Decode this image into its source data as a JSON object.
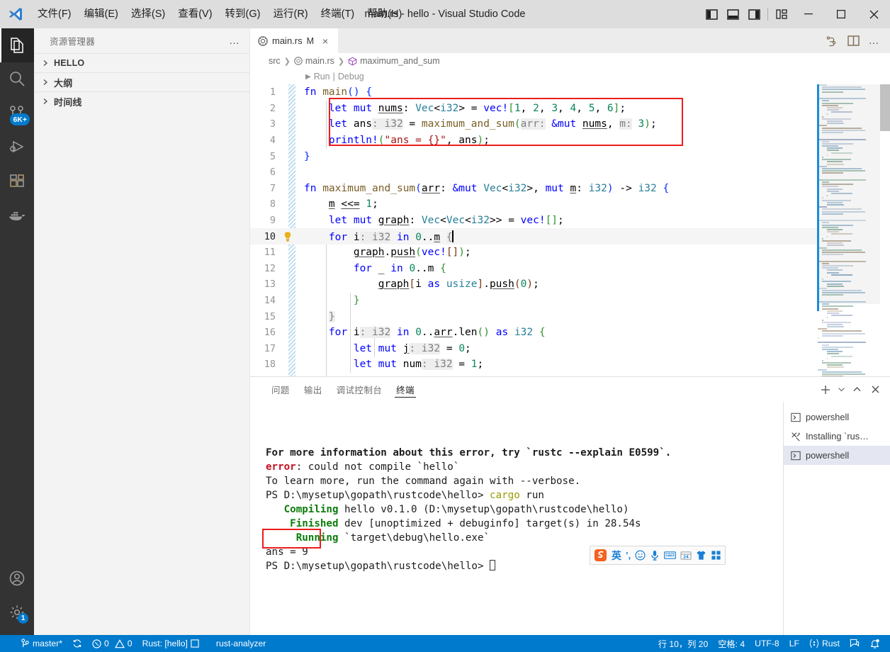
{
  "window": {
    "title": "main.rs - hello - Visual Studio Code",
    "logo_icon": "vscode-logo-icon"
  },
  "menubar": {
    "items": [
      {
        "label": "文件(F)",
        "mnemonic": "F"
      },
      {
        "label": "编辑(E)",
        "mnemonic": "E"
      },
      {
        "label": "选择(S)",
        "mnemonic": "S"
      },
      {
        "label": "查看(V)",
        "mnemonic": "V"
      },
      {
        "label": "转到(G)",
        "mnemonic": "G"
      },
      {
        "label": "运行(R)",
        "mnemonic": "R"
      },
      {
        "label": "终端(T)",
        "mnemonic": "T"
      },
      {
        "label": "帮助(H)",
        "mnemonic": "H"
      }
    ]
  },
  "titlebar_controls": {
    "toggle_primary_sidebar": "toggle-primary-sidebar-icon",
    "toggle_panel": "toggle-panel-icon",
    "toggle_secondary_sidebar": "toggle-secondary-sidebar-icon",
    "customize_layout": "customize-layout-icon",
    "minimize": "minimize-icon",
    "maximize": "maximize-icon",
    "close": "close-icon"
  },
  "activitybar": {
    "items": [
      {
        "name": "explorer",
        "icon": "files-icon",
        "active": true,
        "badge": ""
      },
      {
        "name": "search",
        "icon": "search-icon",
        "active": false,
        "badge": ""
      },
      {
        "name": "source-control",
        "icon": "source-control-icon",
        "active": false,
        "badge": "6K+"
      },
      {
        "name": "run-and-debug",
        "icon": "run-and-debug-icon",
        "active": false,
        "badge": ""
      },
      {
        "name": "extensions",
        "icon": "extensions-icon",
        "active": false,
        "badge": ""
      },
      {
        "name": "docker",
        "icon": "docker-icon",
        "active": false,
        "badge": ""
      }
    ],
    "bottom_items": [
      {
        "name": "accounts",
        "icon": "account-icon",
        "badge": ""
      },
      {
        "name": "settings",
        "icon": "gear-icon",
        "badge": "1"
      }
    ]
  },
  "sidebar": {
    "title": "资源管理器",
    "more_actions": "…",
    "sections": [
      {
        "label": "HELLO",
        "expanded": false,
        "cjk": false
      },
      {
        "label": "大纲",
        "expanded": false,
        "cjk": true
      },
      {
        "label": "时间线",
        "expanded": false,
        "cjk": true
      }
    ]
  },
  "editor": {
    "tab": {
      "filename": "main.rs",
      "modified_marker": "M",
      "close": "×",
      "file_icon": "rust-file-icon"
    },
    "tab_actions": {
      "run_or_debug": "run-debug-icon",
      "split_editor": "split-editor-icon",
      "more": "…"
    },
    "breadcrumb": [
      "src",
      "main.rs",
      "maximum_and_sum"
    ],
    "codelens": {
      "run": "Run",
      "divider": "|",
      "debug": "Debug"
    },
    "cursor_line": 10,
    "lines": [
      {
        "n": 1,
        "html": "<span class=\"k\">fn</span> <span class=\"fn\">main</span><span class=\"br1\">()</span> <span class=\"br1\">{</span>",
        "text": "fn main() {"
      },
      {
        "n": 2,
        "html": "    <span class=\"k\">let</span> <span class=\"k\">mut</span> <span class=\"ud\">nums</span>: <span class=\"ty\">Vec</span>&lt;<span class=\"ty\">i32</span>&gt; = <span class=\"mac\">vec!</span><span class=\"br2\">[</span><span class=\"num\">1</span>, <span class=\"num\">2</span>, <span class=\"num\">3</span>, <span class=\"num\">4</span>, <span class=\"num\">5</span>, <span class=\"num\">6</span><span class=\"br2\">]</span>;",
        "text": "    let mut nums: Vec<i32> = vec![1, 2, 3, 4, 5, 6];"
      },
      {
        "n": 3,
        "html": "    <span class=\"k\">let</span> ans<span class=\"hint\">: i32</span> = <span class=\"fn\">maximum_and_sum</span><span class=\"br2\">(</span><span class=\"hint\">arr:</span> <span class=\"k\">&amp;mut</span> <span class=\"ud\">nums</span>, <span class=\"hint\">m:</span> <span class=\"num\">3</span><span class=\"br2\">)</span>;",
        "text": "    let ans: i32 = maximum_and_sum(arr: &mut nums, m: 3);"
      },
      {
        "n": 4,
        "html": "    <span class=\"mac\">println!</span><span class=\"br2\">(</span><span class=\"str\">\"ans = {}\"</span>, ans<span class=\"br2\">)</span>;",
        "text": "    println!(\"ans = {}\", ans);"
      },
      {
        "n": 5,
        "html": "<span class=\"br1\">}</span>",
        "text": "}"
      },
      {
        "n": 6,
        "html": "",
        "text": ""
      },
      {
        "n": 7,
        "html": "<span class=\"k\">fn</span> <span class=\"fn\">maximum_and_sum</span><span class=\"br1\">(</span><span class=\"ud\">arr</span>: <span class=\"k\">&amp;mut</span> <span class=\"ty\">Vec</span>&lt;<span class=\"ty\">i32</span>&gt;, <span class=\"k\">mut</span> <span class=\"ud\">m</span>: <span class=\"ty\">i32</span><span class=\"br1\">)</span> -&gt; <span class=\"ty\">i32</span> <span class=\"br1\">{</span>",
        "text": "fn maximum_and_sum(arr: &mut Vec<i32>, mut m: i32) -> i32 {"
      },
      {
        "n": 8,
        "html": "    <span class=\"ud\">m</span> <span class=\"ud\">&lt;&lt;=</span> <span class=\"num\">1</span>;",
        "text": "    m <<= 1;"
      },
      {
        "n": 9,
        "html": "    <span class=\"k\">let</span> <span class=\"k\">mut</span> <span class=\"ud\">graph</span>: <span class=\"ty\">Vec</span>&lt;<span class=\"ty\">Vec</span>&lt;<span class=\"ty\">i32</span>&gt;&gt; = <span class=\"mac\">vec!</span><span class=\"br2\">[]</span>;",
        "text": "    let mut graph: Vec<Vec<i32>> = vec![];"
      },
      {
        "n": 10,
        "html": "    <span class=\"k\">for</span> i<span class=\"hint\">: i32</span> <span class=\"k\">in</span> <span class=\"num\">0</span>..<span class=\"ud\">m</span> <span class=\"hint\">{</span>",
        "text": "    for i: i32 in 0..m {",
        "bulb": true,
        "cursor": true
      },
      {
        "n": 11,
        "html": "        <span class=\"ud\">graph</span>.<span class=\"ud\">push</span><span class=\"br2\">(</span><span class=\"mac\">vec!</span><span class=\"br3\">[]</span><span class=\"br2\">)</span>;",
        "text": "        graph.push(vec![]);"
      },
      {
        "n": 12,
        "html": "        <span class=\"k\">for</span> _ <span class=\"k\">in</span> <span class=\"num\">0</span>..<span class=\"pl\">m</span> <span class=\"br2\">{</span>",
        "text": "        for _ in 0..m {"
      },
      {
        "n": 13,
        "html": "            <span class=\"ud\">graph</span><span class=\"br3\">[</span>i <span class=\"k\">as</span> <span class=\"ty\">usize</span><span class=\"br3\">]</span>.<span class=\"ud\">push</span><span class=\"br3\">(</span><span class=\"num\">0</span><span class=\"br3\">)</span>;",
        "text": "            graph[i as usize].push(0);"
      },
      {
        "n": 14,
        "html": "        <span class=\"br2\">}</span>",
        "text": "        }"
      },
      {
        "n": 15,
        "html": "    <span class=\"hint\">}</span>",
        "text": "    }"
      },
      {
        "n": 16,
        "html": "    <span class=\"k\">for</span> i<span class=\"hint\">: i32</span> <span class=\"k\">in</span> <span class=\"num\">0</span>..<span class=\"ud\">arr</span>.<span class=\"pl\">len</span><span class=\"br2\">()</span> <span class=\"k\">as</span> <span class=\"ty\">i32</span> <span class=\"br2\">{</span>",
        "text": "    for i: i32 in 0..arr.len() as i32 {"
      },
      {
        "n": 17,
        "html": "        <span class=\"k\">let</span> <span class=\"k\">mut</span> <span class=\"ud\">j</span><span class=\"hint\">: i32</span> = <span class=\"num\">0</span>;",
        "text": "        let mut j: i32 = 0;"
      },
      {
        "n": 18,
        "html": "        <span class=\"k\">let</span> <span class=\"k\">mut</span> num<span class=\"hint\">: i32</span> = <span class=\"num\">1</span>;",
        "text": "        let mut num: i32 = 1;"
      }
    ],
    "annotations": [
      {
        "name": "code-highlight-box",
        "color": "#ee1c1c",
        "covers_lines": [
          2,
          3,
          4
        ]
      }
    ]
  },
  "panel": {
    "tabs": [
      {
        "label": "问题",
        "active": false
      },
      {
        "label": "输出",
        "active": false
      },
      {
        "label": "调试控制台",
        "active": false
      },
      {
        "label": "终端",
        "active": true
      }
    ],
    "actions": {
      "new_terminal": "plus-icon",
      "new_terminal_dropdown": "chevron-down-icon",
      "maximize_panel": "chevron-up-icon",
      "close_panel": "close-icon"
    },
    "terminal_lines": [
      {
        "segments": [
          {
            "t": "For more information about this error, try `rustc --explain E0599`.",
            "c": "t-bold"
          }
        ]
      },
      {
        "segments": [
          {
            "t": "error",
            "c": "t-red"
          },
          {
            "t": ": could not compile `hello`",
            "c": ""
          }
        ]
      },
      {
        "segments": [
          {
            "t": "",
            "c": ""
          }
        ]
      },
      {
        "segments": [
          {
            "t": "To learn more, run the command again with --verbose.",
            "c": ""
          }
        ]
      },
      {
        "segments": [
          {
            "t": "PS D:\\mysetup\\gopath\\rustcode\\hello> ",
            "c": ""
          },
          {
            "t": "cargo",
            "c": "t-yellow"
          },
          {
            "t": " run",
            "c": ""
          }
        ]
      },
      {
        "segments": [
          {
            "t": "   Compiling",
            "c": "t-green"
          },
          {
            "t": " hello v0.1.0 (D:\\mysetup\\gopath\\rustcode\\hello)",
            "c": ""
          }
        ]
      },
      {
        "segments": [
          {
            "t": "    Finished",
            "c": "t-green"
          },
          {
            "t": " dev [unoptimized + debuginfo] target(s) in 28.54s",
            "c": ""
          }
        ]
      },
      {
        "segments": [
          {
            "t": "     Running",
            "c": "t-green"
          },
          {
            "t": " `target\\debug\\hello.exe`",
            "c": ""
          }
        ]
      },
      {
        "segments": [
          {
            "t": "ans = 9",
            "c": ""
          }
        ]
      },
      {
        "segments": [
          {
            "t": "PS D:\\mysetup\\gopath\\rustcode\\hello> ",
            "c": ""
          }
        ],
        "cursor": true
      }
    ],
    "output_highlight": {
      "name": "terminal-output-highlight-box",
      "text": "ans = 9",
      "color": "#ee1c1c"
    },
    "terminal_list": [
      {
        "label": "powershell",
        "icon": "terminal-powershell-icon",
        "active": false
      },
      {
        "label": "Installing `rus…",
        "icon": "tools-icon",
        "active": false
      },
      {
        "label": "powershell",
        "icon": "terminal-powershell-icon",
        "active": true
      }
    ]
  },
  "ime_toolbar": {
    "items": [
      {
        "name": "sogou-logo-icon",
        "glyph": "S"
      },
      {
        "name": "input-mode-english-icon",
        "glyph": "英"
      },
      {
        "name": "punctuation-icon",
        "glyph": "’,"
      },
      {
        "name": "emoji-icon",
        "glyph": "☺"
      },
      {
        "name": "voice-input-icon",
        "glyph": "🎤"
      },
      {
        "name": "soft-keyboard-icon",
        "glyph": "⌨"
      },
      {
        "name": "calendar-icon",
        "glyph": "24"
      },
      {
        "name": "skin-icon",
        "glyph": "👕"
      },
      {
        "name": "toolbox-icon",
        "glyph": "▣"
      }
    ]
  },
  "statusbar": {
    "left": [
      {
        "name": "git-branch",
        "icon": "source-control-icon",
        "label": "master*"
      },
      {
        "name": "sync-changes",
        "icon": "sync-icon",
        "label": ""
      },
      {
        "name": "problems",
        "icon": "error-warning-icon",
        "label": "0  0",
        "errors": "0",
        "warnings": "0"
      },
      {
        "name": "rust-toolchain",
        "icon": "",
        "label": "Rust: [hello]"
      },
      {
        "name": "rust-analyzer",
        "icon": "",
        "label": "rust-analyzer"
      }
    ],
    "right": [
      {
        "name": "cursor-position",
        "label": "行 10，列 20"
      },
      {
        "name": "indentation",
        "label": "空格: 4"
      },
      {
        "name": "encoding",
        "label": "UTF-8"
      },
      {
        "name": "eol",
        "label": "LF"
      },
      {
        "name": "language-mode",
        "label": "Rust",
        "icon": "rust-icon"
      },
      {
        "name": "feedback",
        "label": "",
        "icon": "feedback-icon"
      },
      {
        "name": "notifications",
        "label": "",
        "icon": "bell-dot-icon"
      }
    ],
    "accent_color": "#007acc"
  },
  "colors": {
    "titlebar_bg": "#dddddd",
    "activitybar_bg": "#333333",
    "sidebar_bg": "#f3f3f3",
    "editor_bg": "#ffffff",
    "statusbar_bg": "#007acc",
    "highlight_red": "#ee1c1c",
    "badge_blue": "#007acc",
    "terminal_green": "#0a7c0a",
    "terminal_red": "#c50f1f"
  }
}
